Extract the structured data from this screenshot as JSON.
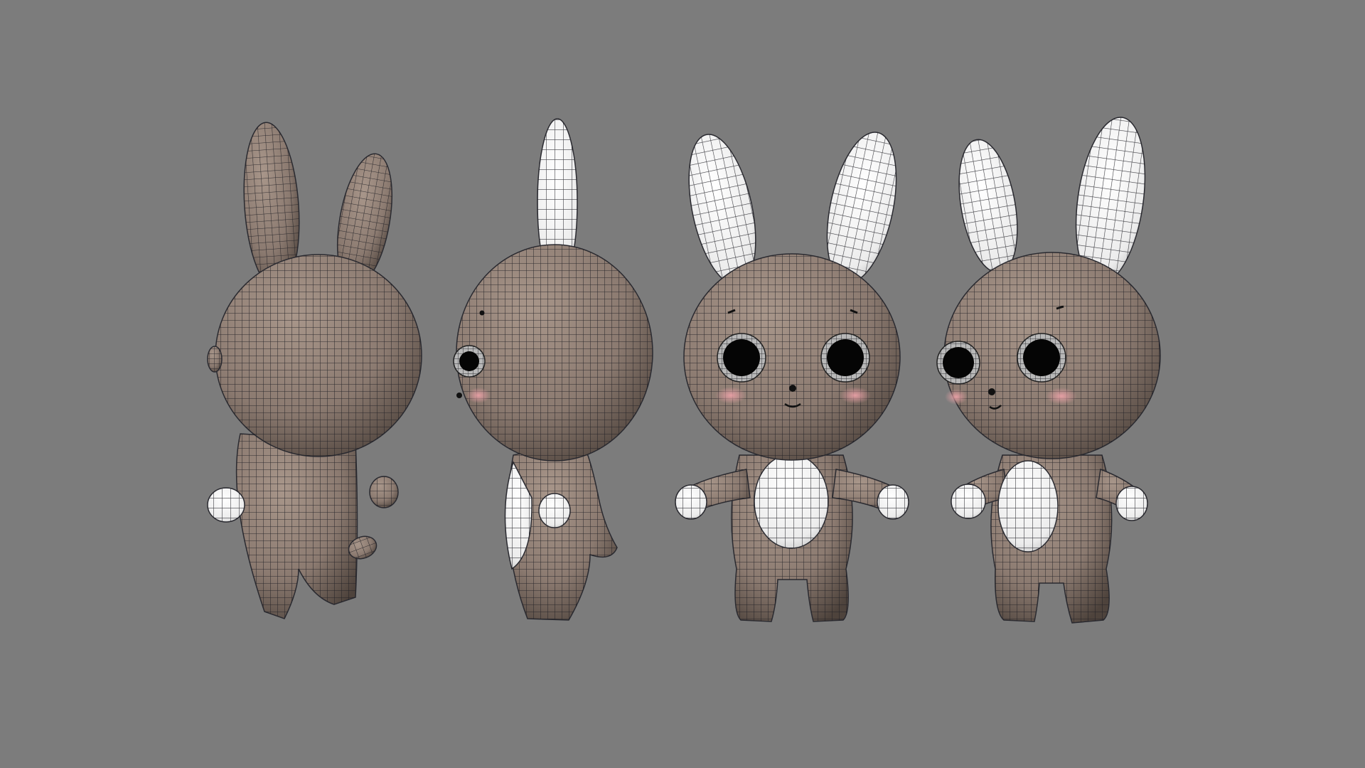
{
  "viewport": {
    "background": "#7c7c7c",
    "wire_color": "#1c1c22",
    "body_color": "#8b7a70",
    "body_highlight": "#a8968a",
    "body_shadow": "#4e433c",
    "white_color": "#ececec",
    "blush_color": "#e9a0a6",
    "eye_color": "#050505",
    "eye_ring_color": "#b8b8b8"
  },
  "models": [
    {
      "name": "bunny-back-quarter-view",
      "view": "back-three-quarter"
    },
    {
      "name": "bunny-side-view",
      "view": "side"
    },
    {
      "name": "bunny-front-view",
      "view": "front"
    },
    {
      "name": "bunny-front-quarter-view",
      "view": "front-three-quarter"
    }
  ]
}
